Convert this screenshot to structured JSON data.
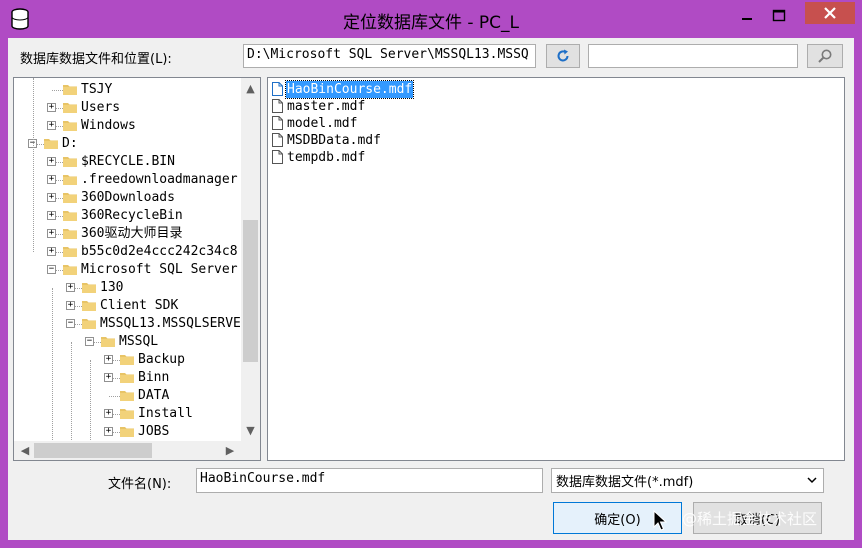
{
  "window": {
    "title": "定位数据库文件 - PC_L",
    "accent_color": "#b04bc4"
  },
  "location": {
    "label": "数据库数据文件和位置(L):",
    "path_value": "D:\\Microsoft SQL Server\\MSSQL13.MSSQ",
    "search_value": "",
    "refresh_icon": "refresh-icon",
    "search_icon": "search-icon"
  },
  "tree": {
    "items": [
      {
        "label": "TSJY",
        "depth": 1,
        "expander": "",
        "type": "folder"
      },
      {
        "label": "Users",
        "depth": 1,
        "expander": "+",
        "type": "folder"
      },
      {
        "label": "Windows",
        "depth": 1,
        "expander": "+",
        "type": "folder"
      },
      {
        "label": "D:",
        "depth": 0,
        "expander": "-",
        "type": "folder"
      },
      {
        "label": "$RECYCLE.BIN",
        "depth": 1,
        "expander": "+",
        "type": "folder"
      },
      {
        "label": ".freedownloadmanager",
        "depth": 1,
        "expander": "+",
        "type": "folder"
      },
      {
        "label": "360Downloads",
        "depth": 1,
        "expander": "+",
        "type": "folder"
      },
      {
        "label": "360RecycleBin",
        "depth": 1,
        "expander": "+",
        "type": "folder"
      },
      {
        "label": "360驱动大师目录",
        "depth": 1,
        "expander": "+",
        "type": "folder"
      },
      {
        "label": "b55c0d2e4ccc242c34c8",
        "depth": 1,
        "expander": "+",
        "type": "folder"
      },
      {
        "label": "Microsoft SQL Server",
        "depth": 1,
        "expander": "-",
        "type": "folder"
      },
      {
        "label": "130",
        "depth": 2,
        "expander": "+",
        "type": "folder"
      },
      {
        "label": "Client SDK",
        "depth": 2,
        "expander": "+",
        "type": "folder"
      },
      {
        "label": "MSSQL13.MSSQLSERVE",
        "depth": 2,
        "expander": "-",
        "type": "folder"
      },
      {
        "label": "MSSQL",
        "depth": 3,
        "expander": "-",
        "type": "folder"
      },
      {
        "label": "Backup",
        "depth": 4,
        "expander": "+",
        "type": "folder"
      },
      {
        "label": "Binn",
        "depth": 4,
        "expander": "+",
        "type": "folder"
      },
      {
        "label": "DATA",
        "depth": 4,
        "expander": "",
        "type": "folder"
      },
      {
        "label": "Install",
        "depth": 4,
        "expander": "+",
        "type": "folder"
      },
      {
        "label": "JOBS",
        "depth": 4,
        "expander": "+",
        "type": "folder"
      }
    ]
  },
  "files": {
    "items": [
      {
        "name": "HaoBinCourse.mdf",
        "selected": true
      },
      {
        "name": "master.mdf",
        "selected": false
      },
      {
        "name": "model.mdf",
        "selected": false
      },
      {
        "name": "MSDBData.mdf",
        "selected": false
      },
      {
        "name": "tempdb.mdf",
        "selected": false
      }
    ]
  },
  "filename": {
    "label": "文件名(N):",
    "value": "HaoBinCourse.mdf"
  },
  "filetype": {
    "selected": "数据库数据文件(*.mdf)"
  },
  "buttons": {
    "ok_label": "确定(O)",
    "cancel_label": "取消(C)"
  },
  "watermark": {
    "text": "@稀土掘金技术社区"
  }
}
